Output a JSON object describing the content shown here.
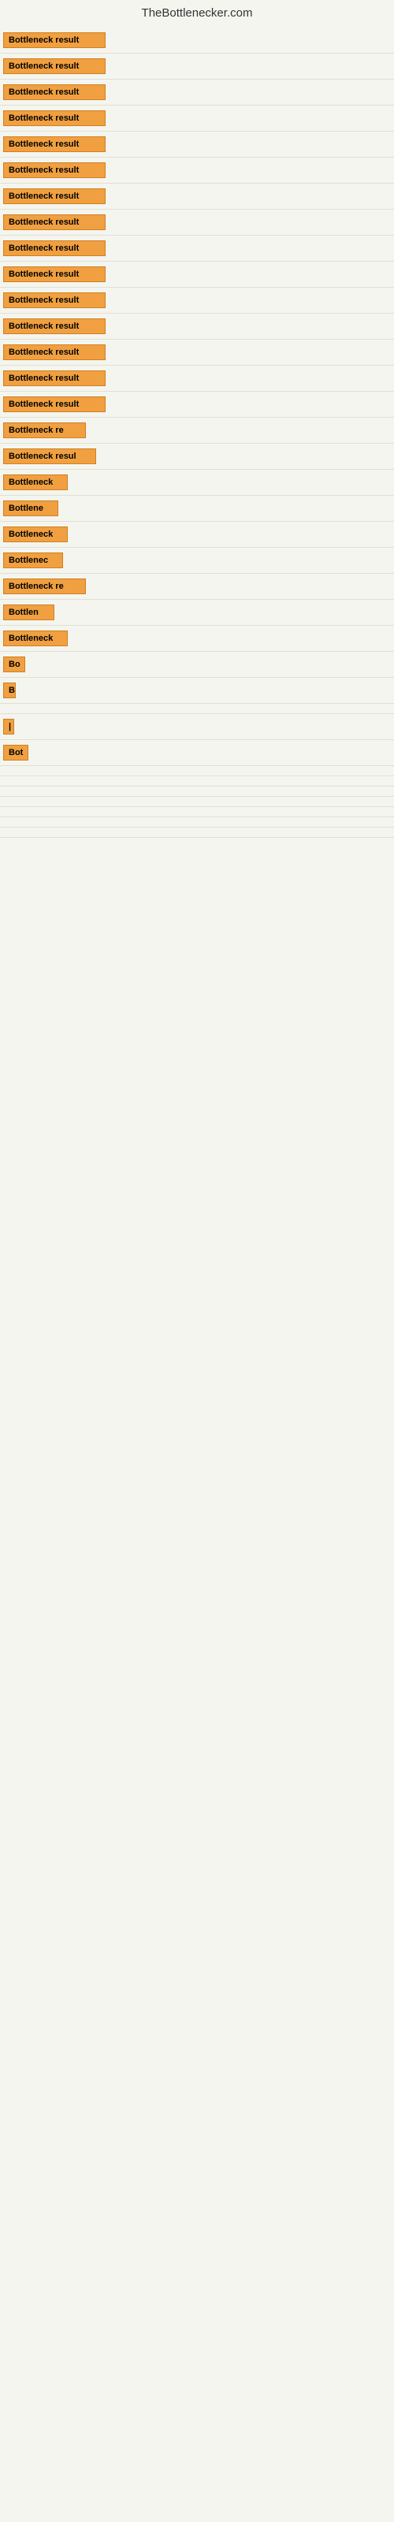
{
  "site": {
    "title": "TheBottlenecker.com"
  },
  "items": [
    {
      "badge": "Bottleneck result",
      "width": 130
    },
    {
      "badge": "Bottleneck result",
      "width": 130
    },
    {
      "badge": "Bottleneck result",
      "width": 130
    },
    {
      "badge": "Bottleneck result",
      "width": 130
    },
    {
      "badge": "Bottleneck result",
      "width": 130
    },
    {
      "badge": "Bottleneck result",
      "width": 130
    },
    {
      "badge": "Bottleneck result",
      "width": 130
    },
    {
      "badge": "Bottleneck result",
      "width": 130
    },
    {
      "badge": "Bottleneck result",
      "width": 130
    },
    {
      "badge": "Bottleneck result",
      "width": 130
    },
    {
      "badge": "Bottleneck result",
      "width": 130
    },
    {
      "badge": "Bottleneck result",
      "width": 130
    },
    {
      "badge": "Bottleneck result",
      "width": 130
    },
    {
      "badge": "Bottleneck result",
      "width": 130
    },
    {
      "badge": "Bottleneck result",
      "width": 130
    },
    {
      "badge": "Bottleneck re",
      "width": 105
    },
    {
      "badge": "Bottleneck resul",
      "width": 118
    },
    {
      "badge": "Bottleneck",
      "width": 82
    },
    {
      "badge": "Bottlene",
      "width": 70
    },
    {
      "badge": "Bottleneck",
      "width": 82
    },
    {
      "badge": "Bottlenec",
      "width": 76
    },
    {
      "badge": "Bottleneck re",
      "width": 105
    },
    {
      "badge": "Bottlen",
      "width": 65
    },
    {
      "badge": "Bottleneck",
      "width": 82
    },
    {
      "badge": "Bo",
      "width": 28
    },
    {
      "badge": "B",
      "width": 16
    },
    {
      "badge": "",
      "width": 8
    },
    {
      "badge": "|",
      "width": 6
    },
    {
      "badge": "Bot",
      "width": 32
    },
    {
      "badge": "",
      "width": 0
    },
    {
      "badge": "",
      "width": 0
    },
    {
      "badge": "",
      "width": 0
    },
    {
      "badge": "",
      "width": 0
    },
    {
      "badge": "",
      "width": 0
    },
    {
      "badge": "",
      "width": 0
    },
    {
      "badge": "",
      "width": 0
    }
  ]
}
